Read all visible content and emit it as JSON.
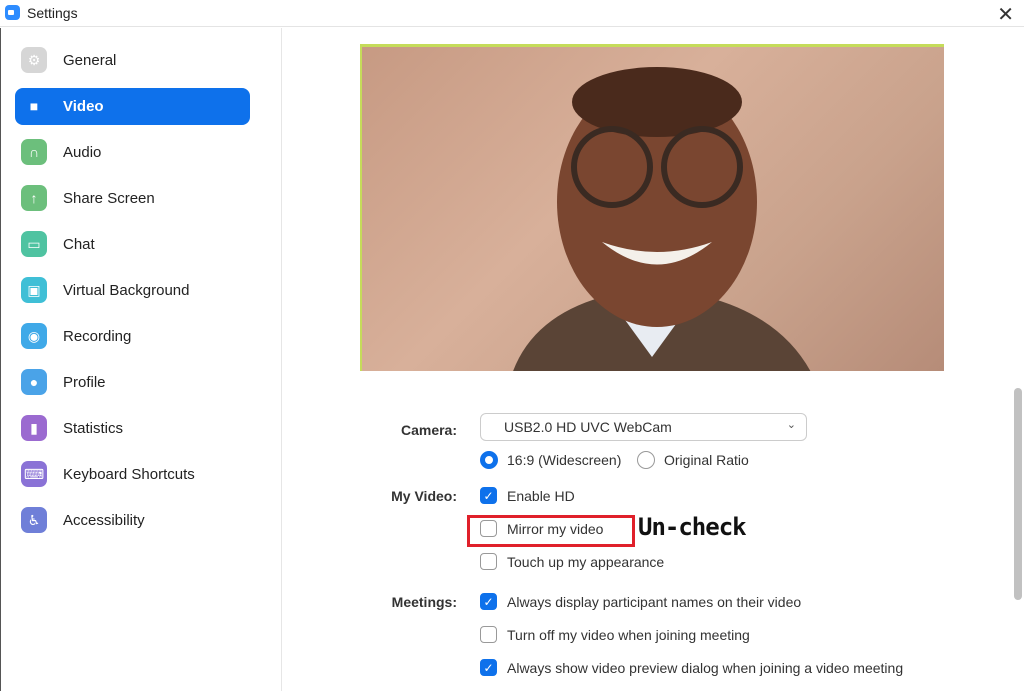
{
  "window": {
    "title": "Settings",
    "close_icon": "close-icon"
  },
  "sidebar": {
    "items": [
      {
        "label": "General",
        "icon": "gear-icon",
        "color": "#d6d6d6"
      },
      {
        "label": "Video",
        "icon": "video-camera-icon",
        "color": "#0e71eb",
        "active": true
      },
      {
        "label": "Audio",
        "icon": "headphones-icon",
        "color": "#6cbf7c"
      },
      {
        "label": "Share Screen",
        "icon": "share-screen-icon",
        "color": "#6cbf7c"
      },
      {
        "label": "Chat",
        "icon": "chat-icon",
        "color": "#4fc3a1"
      },
      {
        "label": "Virtual Background",
        "icon": "virtual-background-icon",
        "color": "#3fbfd6"
      },
      {
        "label": "Recording",
        "icon": "recording-icon",
        "color": "#3fa9e8"
      },
      {
        "label": "Profile",
        "icon": "profile-icon",
        "color": "#4aa3e8"
      },
      {
        "label": "Statistics",
        "icon": "statistics-icon",
        "color": "#9b6ad0"
      },
      {
        "label": "Keyboard Shortcuts",
        "icon": "keyboard-icon",
        "color": "#8a72d6"
      },
      {
        "label": "Accessibility",
        "icon": "accessibility-icon",
        "color": "#6f7fd8"
      }
    ]
  },
  "video": {
    "camera_label": "Camera:",
    "camera_value": "USB2.0 HD UVC WebCam",
    "ratio_options": [
      {
        "label": "16:9 (Widescreen)",
        "selected": true
      },
      {
        "label": "Original Ratio",
        "selected": false
      }
    ],
    "my_video_label": "My Video:",
    "my_video_options": [
      {
        "label": "Enable HD",
        "checked": true
      },
      {
        "label": "Mirror my video",
        "checked": false
      },
      {
        "label": "Touch up my appearance",
        "checked": false
      }
    ],
    "meetings_label": "Meetings:",
    "meetings_options": [
      {
        "label": "Always display participant names on their video",
        "checked": true
      },
      {
        "label": "Turn off my video when joining meeting",
        "checked": false
      },
      {
        "label": "Always show video preview dialog when joining a video meeting",
        "checked": true
      }
    ]
  },
  "annotation": {
    "text": "Un-check",
    "color": "#e0202a"
  }
}
